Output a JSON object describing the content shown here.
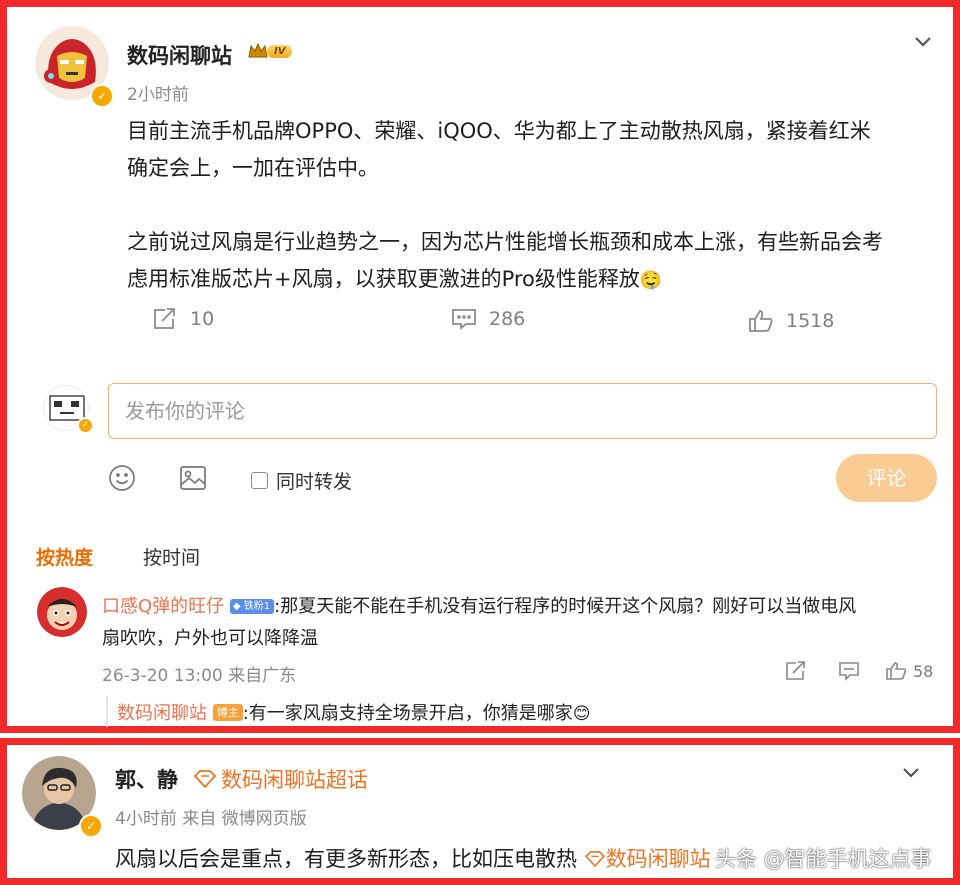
{
  "post": {
    "author": "数码闲聊站",
    "level_badge": "IV",
    "time": "2小时前",
    "paragraph1_line1": "目前主流手机品牌OPPO、荣耀、iQOO、华为都上了主动散热风扇，紧接着红米",
    "paragraph1_line2": "确定会上，一加在评估中。",
    "paragraph2_line1": "之前说过风扇是行业趋势之一，因为芯片性能增长瓶颈和成本上涨，有些新品会考",
    "paragraph2_line2": "虑用标准版芯片+风扇，以获取更激进的Pro级性能释放",
    "emoji": "🤤",
    "repost_count": "10",
    "comment_count": "286",
    "like_count": "1518"
  },
  "composer": {
    "placeholder": "发布你的评论",
    "also_repost_label": "同时转发",
    "submit_label": "评论"
  },
  "sort": {
    "hot": "按热度",
    "time": "按时间"
  },
  "comment": {
    "user": "口感Q弹的旺仔",
    "fan_badge": "铁粉1",
    "line1": ":那夏天能不能在手机没有运行程序的时候开这个风扇？刚好可以当做电风",
    "line2": "扇吹吹，户外也可以降降温",
    "time": "26-3-20 13:00 来自广东",
    "like_count": "58",
    "reply": {
      "user": "数码闲聊站",
      "badge": "博主",
      "text": ":有一家风扇支持全场景开启，你猜是哪家",
      "emoji": "😊"
    }
  },
  "post2": {
    "author": "郭、静",
    "topic": "数码闲聊站超话",
    "meta": "4小时前 来自 微博网页版",
    "text": "风扇以后会是重点，有更多新形态，比如压电散热",
    "topic_tag": "数码闲聊站",
    "watermark": "头条 @智能手机这点事"
  },
  "colors": {
    "frame": "#f02a2a",
    "accent_orange": "#f06b00",
    "comment_user": "#eb7350",
    "verify_badge": "#f7a700"
  }
}
